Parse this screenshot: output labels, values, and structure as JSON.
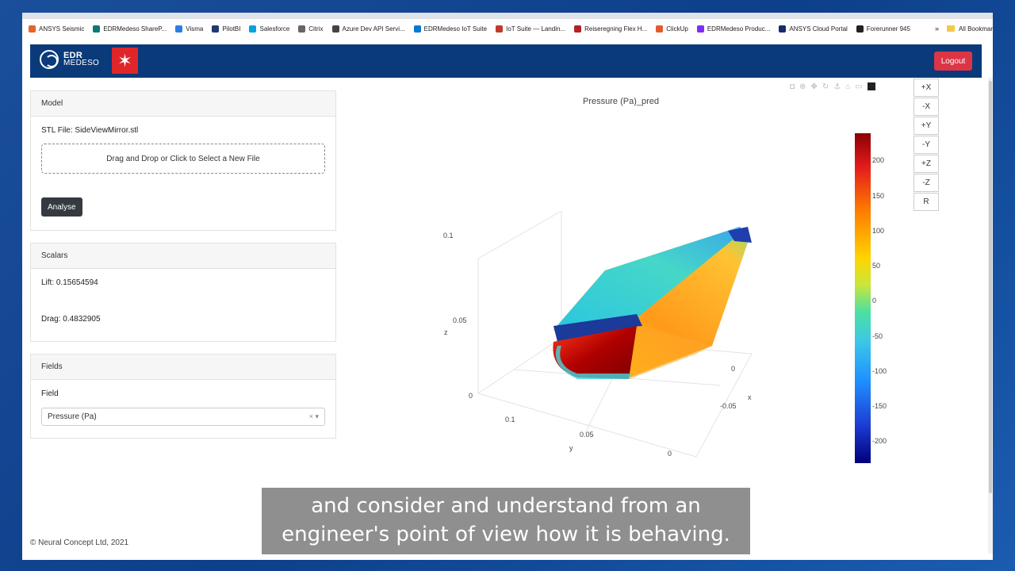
{
  "bookmarks": [
    {
      "label": "ANSYS Seismic",
      "color": "#e8632b"
    },
    {
      "label": "EDRMedeso ShareP...",
      "color": "#0b7a75"
    },
    {
      "label": "Visma",
      "color": "#2a7de1"
    },
    {
      "label": "PilotBI",
      "color": "#1f3b6e"
    },
    {
      "label": "Salesforce",
      "color": "#00a1e0"
    },
    {
      "label": "Citrix",
      "color": "#666666"
    },
    {
      "label": "Azure Dev API Servi...",
      "color": "#444444"
    },
    {
      "label": "EDRMedeso IoT Suite",
      "color": "#0078d4"
    },
    {
      "label": "IoT Suite — Landin...",
      "color": "#c0392b"
    },
    {
      "label": "Reiseregning Flex H...",
      "color": "#b22222"
    },
    {
      "label": "ClickUp",
      "color": "#e35a2e"
    },
    {
      "label": "EDRMedeso Produc...",
      "color": "#7b2ff7"
    },
    {
      "label": "ANSYS Cloud Portal",
      "color": "#1b2a6b"
    },
    {
      "label": "Forerunner 945",
      "color": "#222222"
    }
  ],
  "bookmarks_more": "»",
  "bookmarks_all": "All Bookmarks",
  "header": {
    "logo_top": "EDR",
    "logo_bottom": "MEDESO",
    "red_logo": "✶",
    "logout_label": "Logout"
  },
  "model": {
    "title": "Model",
    "stl_file": "STL File: SideViewMirror.stl",
    "dropzone": "Drag and Drop or Click to Select a New File",
    "analyse_label": "Analyse"
  },
  "scalars": {
    "title": "Scalars",
    "lift": "Lift: 0.15654594",
    "drag": "Drag: 0.4832905"
  },
  "fields": {
    "title": "Fields",
    "label": "Field",
    "selected": "Pressure (Pa)",
    "clear": "×",
    "caret": "▾"
  },
  "footer": "© Neural Concept Ltd, 2021",
  "view_buttons": [
    "+X",
    "-X",
    "+Y",
    "-Y",
    "+Z",
    "-Z",
    "R"
  ],
  "modebar_icons": [
    "camera-icon",
    "zoom-icon",
    "pan-icon",
    "orbit-icon",
    "turntable-icon",
    "home-icon",
    "camera-reset-icon",
    "plotly-logo-icon"
  ],
  "chart_data": {
    "type": "surface3d",
    "title": "Pressure (Pa)_pred",
    "colorbar": {
      "ticks": [
        "200",
        "150",
        "100",
        "50",
        "0",
        "-50",
        "-100",
        "-150",
        "-200"
      ],
      "range": [
        -230,
        240
      ]
    },
    "axes": {
      "x": {
        "label": "x",
        "ticks": [
          "0",
          "-0.05"
        ]
      },
      "y": {
        "label": "y",
        "ticks": [
          "0.1",
          "0.05",
          "0"
        ]
      },
      "z": {
        "label": "z",
        "ticks": [
          "0.1",
          "0.05",
          "0"
        ]
      }
    }
  },
  "caption": {
    "line1": "and consider and understand from an",
    "line2": "engineer's point of view how it is behaving."
  }
}
